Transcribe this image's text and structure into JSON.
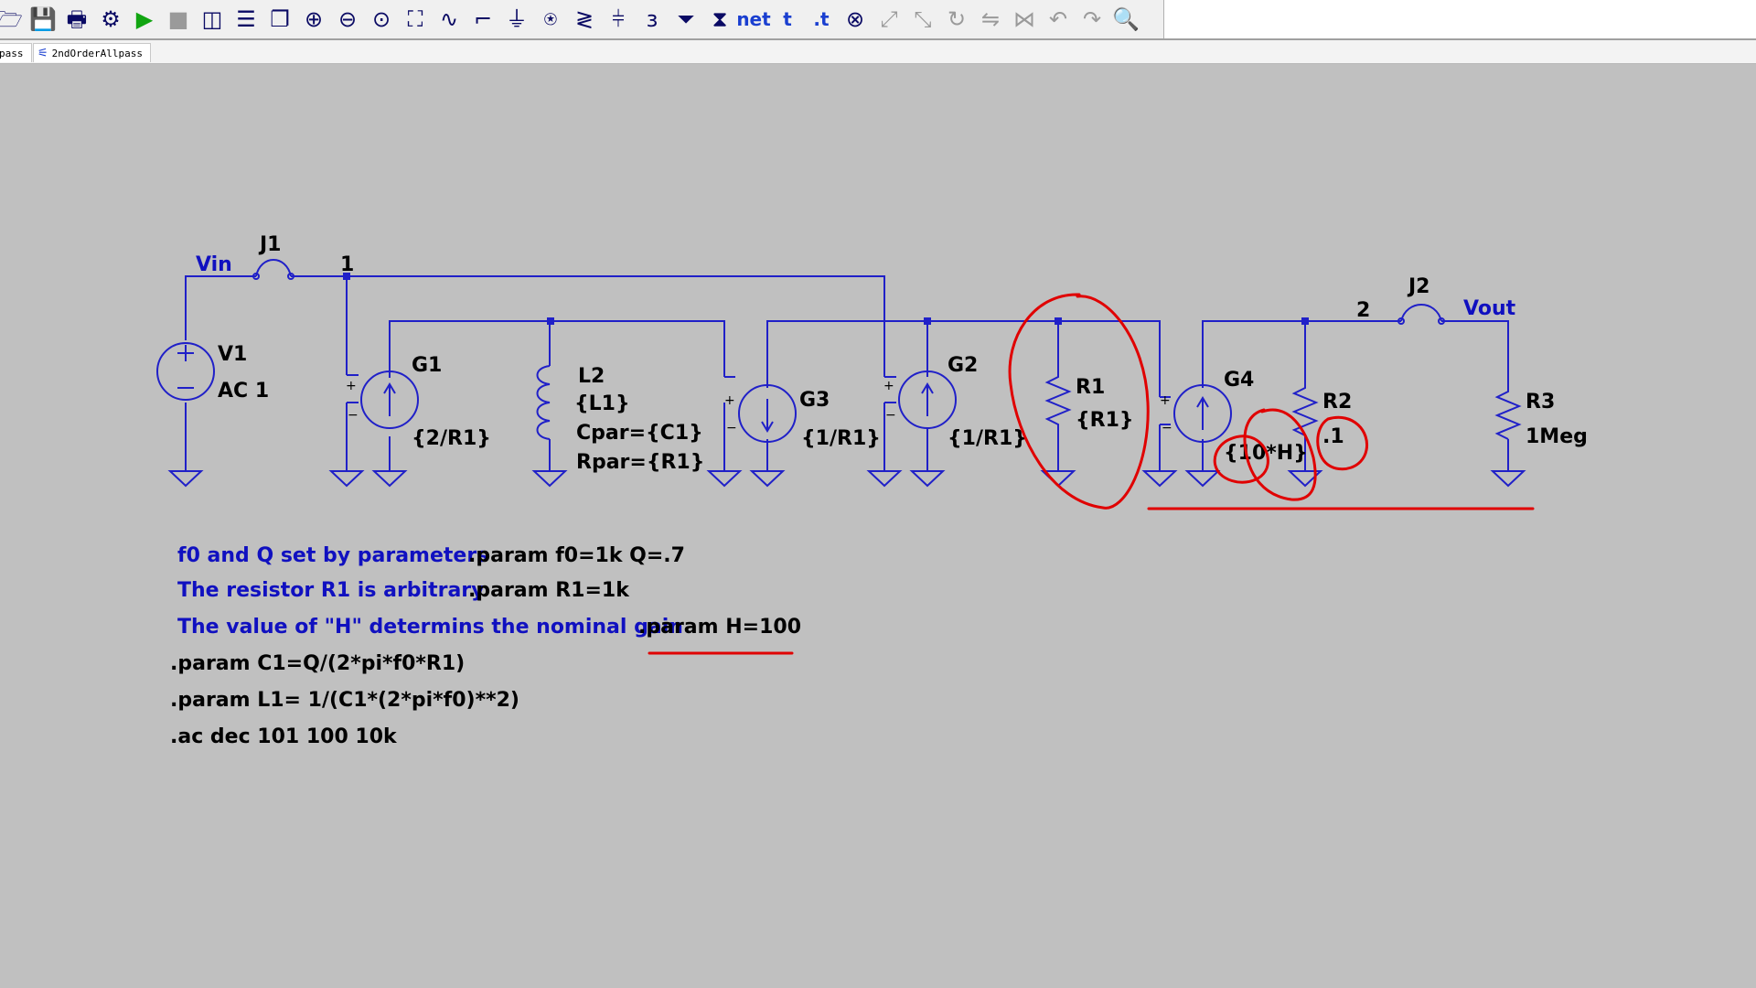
{
  "toolbar": {
    "icons": [
      {
        "name": "open-icon",
        "glyph": "🗁"
      },
      {
        "name": "save-icon",
        "glyph": "💾"
      },
      {
        "name": "print-icon",
        "glyph": "🖶"
      },
      {
        "name": "control-panel-icon",
        "glyph": "⚙"
      },
      {
        "name": "run-icon",
        "glyph": "▶"
      },
      {
        "name": "halt-icon",
        "glyph": "■"
      },
      {
        "name": "tile-vertical-icon",
        "glyph": "◫"
      },
      {
        "name": "tile-horizontal-icon",
        "glyph": "☰"
      },
      {
        "name": "cascade-icon",
        "glyph": "❐"
      },
      {
        "name": "zoom-in-icon",
        "glyph": "⊕"
      },
      {
        "name": "zoom-out-icon",
        "glyph": "⊖"
      },
      {
        "name": "zoom-fit-icon",
        "glyph": "⊙"
      },
      {
        "name": "autorange-icon",
        "glyph": "⛶"
      },
      {
        "name": "fft-icon",
        "glyph": "∿"
      },
      {
        "name": "wire-icon",
        "glyph": "⌐"
      },
      {
        "name": "ground-icon",
        "glyph": "⏚"
      },
      {
        "name": "label-net-icon",
        "glyph": "⍟"
      },
      {
        "name": "resistor-icon",
        "glyph": "≷"
      },
      {
        "name": "capacitor-icon",
        "glyph": "⫩"
      },
      {
        "name": "inductor-icon",
        "glyph": "ɜ"
      },
      {
        "name": "diode-icon",
        "glyph": "⏷"
      },
      {
        "name": "component-icon",
        "glyph": "⧗"
      },
      {
        "name": "net-name-icon",
        "glyph": "net",
        "text": true
      },
      {
        "name": "text-icon",
        "glyph": "t",
        "text": true
      },
      {
        "name": "spice-directive-icon",
        "glyph": ".t",
        "text": true
      },
      {
        "name": "delete-icon",
        "glyph": "⊗"
      },
      {
        "name": "move-icon",
        "glyph": "⤢"
      },
      {
        "name": "drag-icon",
        "glyph": "⤡"
      },
      {
        "name": "rotate-icon",
        "glyph": "↻"
      },
      {
        "name": "mirror-icon",
        "glyph": "⇋"
      },
      {
        "name": "mirror-vertical-icon",
        "glyph": "⋈"
      },
      {
        "name": "undo-icon",
        "glyph": "↶"
      },
      {
        "name": "redo-icon",
        "glyph": "↷"
      },
      {
        "name": "find-icon",
        "glyph": "🔍"
      }
    ]
  },
  "tabs": [
    {
      "label": "pass"
    },
    {
      "label": "2ndOrderAllpass"
    }
  ],
  "schematic": {
    "nets": {
      "vin": "Vin",
      "vout": "Vout",
      "node1": "1",
      "node2": "2"
    },
    "components": {
      "v1": {
        "name": "V1",
        "value": "AC 1"
      },
      "j1": {
        "name": "J1"
      },
      "j2": {
        "name": "J2"
      },
      "g1": {
        "name": "G1",
        "value": "{2/R1}"
      },
      "l2": {
        "name": "L2",
        "value": "{L1}",
        "cpar": "Cpar={C1}",
        "rpar": "Rpar={R1}"
      },
      "g3": {
        "name": "G3",
        "value": "{1/R1}"
      },
      "g2": {
        "name": "G2",
        "value": "{1/R1}"
      },
      "r1": {
        "name": "R1",
        "value": "{R1}"
      },
      "g4": {
        "name": "G4",
        "value": "{10*H}"
      },
      "r2": {
        "name": "R2",
        "value": ".1"
      },
      "r3": {
        "name": "R3",
        "value": "1Meg"
      }
    },
    "comments": [
      "f0 and Q set by parameters",
      "The resistor R1 is arbitrary",
      "The value of \"H\" determins the nominal gain"
    ],
    "directives": [
      ".param f0=1k Q=.7",
      ".param R1=1k",
      ".param H=100",
      ".param C1=Q/(2*pi*f0*R1)",
      ".param L1= 1/(C1*(2*pi*f0)**2)",
      ".ac dec 101 100 10k"
    ]
  },
  "colors": {
    "wire": "#2020c8",
    "annotation": "#e00000",
    "background": "#c0c0c0",
    "net_label": "#1010c0"
  }
}
